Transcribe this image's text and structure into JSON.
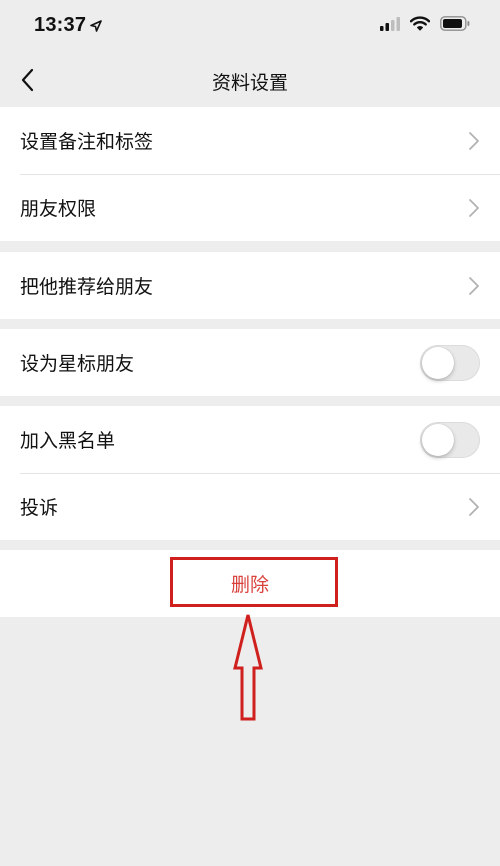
{
  "status_bar": {
    "time": "13:37",
    "icons": [
      "location-arrow-icon",
      "signal-icon",
      "wifi-icon",
      "battery-icon"
    ]
  },
  "nav": {
    "title": "资料设置",
    "back_icon": "chevron-left-icon"
  },
  "groups": [
    {
      "items": [
        {
          "label": "设置备注和标签",
          "control": "chevron"
        },
        {
          "label": "朋友权限",
          "control": "chevron"
        }
      ]
    },
    {
      "items": [
        {
          "label": "把他推荐给朋友",
          "control": "chevron"
        }
      ]
    },
    {
      "items": [
        {
          "label": "设为星标朋友",
          "control": "toggle",
          "on": false
        }
      ]
    },
    {
      "items": [
        {
          "label": "加入黑名单",
          "control": "toggle",
          "on": false
        },
        {
          "label": "投诉",
          "control": "chevron"
        }
      ]
    }
  ],
  "delete": {
    "label": "删除",
    "color": "#d9413c"
  },
  "annotation": {
    "color": "#d0201d",
    "target": "delete-button"
  },
  "colors": {
    "background": "#ededed",
    "card": "#ffffff",
    "divider": "#e4e4e4"
  }
}
